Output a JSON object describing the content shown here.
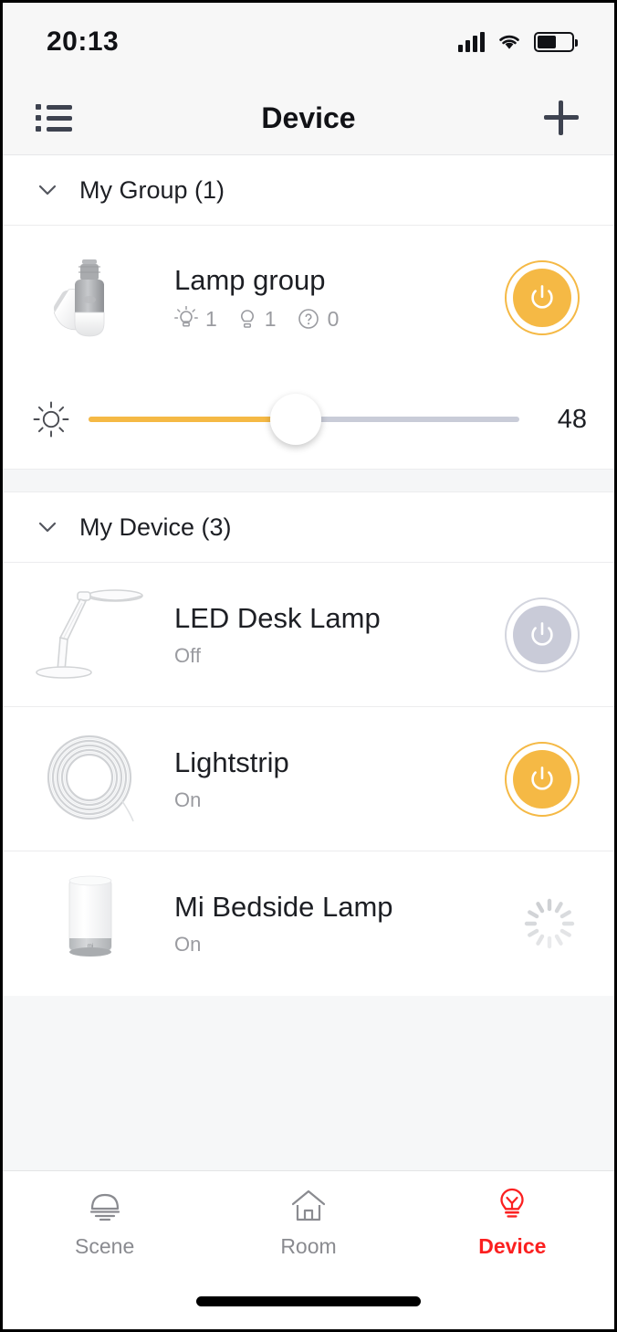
{
  "status_bar": {
    "time": "20:13",
    "signal_icon": "signal-bars-icon",
    "wifi_icon": "wifi-icon",
    "battery_icon": "battery-icon",
    "battery_level_pct": 56
  },
  "header": {
    "title": "Device",
    "menu_icon": "list-menu-icon",
    "add_icon": "plus-icon"
  },
  "sections": [
    {
      "id": "my-group",
      "title": "My Group (1)",
      "chevron_icon": "chevron-down-icon",
      "expanded": true
    },
    {
      "id": "my-device",
      "title": "My Device (3)",
      "chevron_icon": "chevron-down-icon",
      "expanded": true
    }
  ],
  "group": {
    "name": "Lamp group",
    "thumbnail_icon": "smart-bulbs-photo",
    "power_state": "on",
    "power_icon": "power-icon",
    "stats": [
      {
        "icon": "bulb-on-icon",
        "value": "1"
      },
      {
        "icon": "bulb-off-icon",
        "value": "1"
      },
      {
        "icon": "question-circle-icon",
        "value": "0"
      }
    ],
    "brightness": {
      "icon": "brightness-sun-icon",
      "value": "48",
      "percent": 48,
      "min": 0,
      "max": 100
    }
  },
  "devices": [
    {
      "name": "LED Desk Lamp",
      "status": "Off",
      "thumbnail_icon": "desk-lamp-photo",
      "power_state": "off",
      "power_icon": "power-icon"
    },
    {
      "name": "Lightstrip",
      "status": "On",
      "thumbnail_icon": "lightstrip-coil-photo",
      "power_state": "on",
      "power_icon": "power-icon"
    },
    {
      "name": "Mi Bedside Lamp",
      "status": "On",
      "thumbnail_icon": "bedside-lamp-photo",
      "power_state": "loading",
      "power_icon": "loading-spinner-icon"
    }
  ],
  "tabbar": {
    "items": [
      {
        "label": "Scene",
        "icon": "lampshade-icon",
        "active": false
      },
      {
        "label": "Room",
        "icon": "house-icon",
        "active": false
      },
      {
        "label": "Device",
        "icon": "bulb-icon",
        "active": true
      }
    ]
  },
  "colors": {
    "accent_on": "#F5B945",
    "accent_off": "#C9CBD8",
    "active_tab": "#FB2020",
    "text_primary": "#1D1F24",
    "text_secondary": "#9A9BA0"
  }
}
